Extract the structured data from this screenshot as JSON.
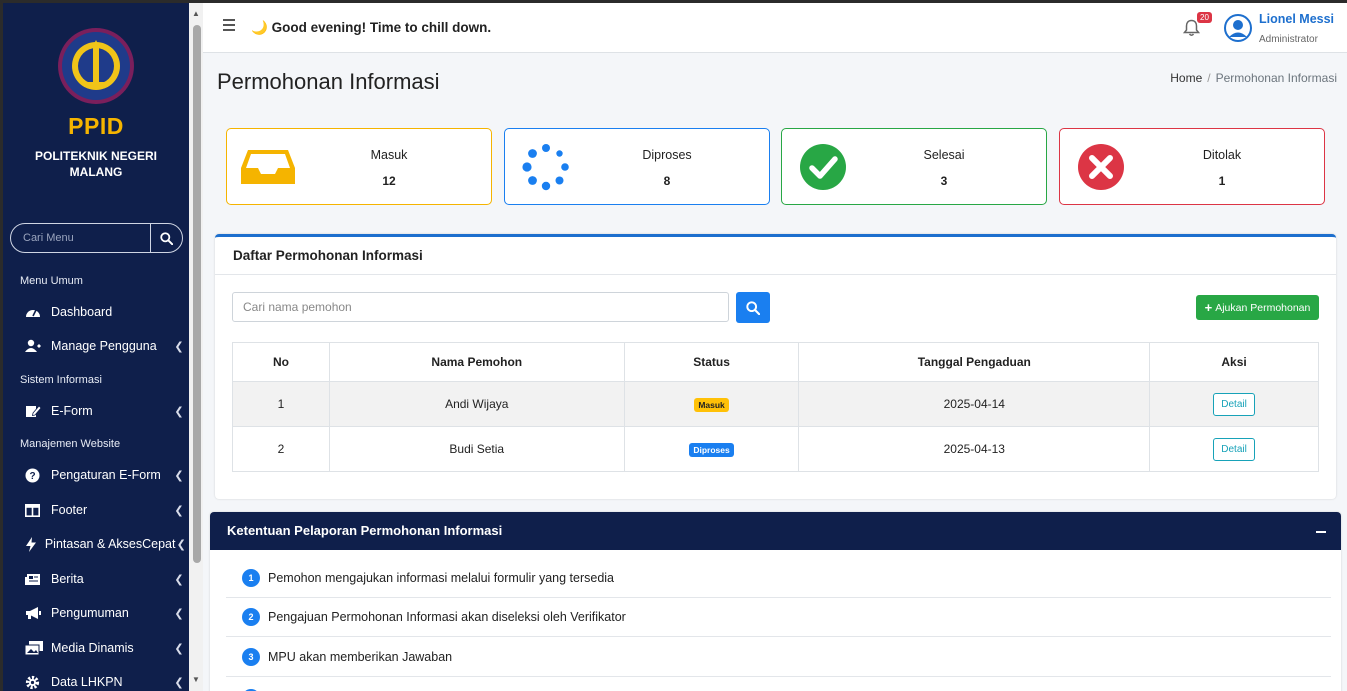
{
  "sidebar": {
    "brand_title": "PPID",
    "brand_sub_line1": "POLITEKNIK NEGERI",
    "brand_sub_line2": "MALANG",
    "logo_text": "POLITEKNIK NEGERI MALANG",
    "search_placeholder": "Cari Menu",
    "sections": [
      "Menu Umum",
      "Sistem Informasi",
      "Manajemen Website"
    ],
    "items": [
      {
        "label": "Dashboard",
        "icon": "dashboard-icon"
      },
      {
        "label": "Manage Pengguna",
        "icon": "users-icon"
      },
      {
        "label": "E-Form",
        "icon": "edit-icon"
      },
      {
        "label": "Pengaturan E-Form",
        "icon": "question-icon"
      },
      {
        "label": "Footer",
        "icon": "layout-icon"
      },
      {
        "label": "Pintasan & AksesCepat",
        "icon": "bolt-icon"
      },
      {
        "label": "Berita",
        "icon": "newspaper-icon"
      },
      {
        "label": "Pengumuman",
        "icon": "megaphone-icon"
      },
      {
        "label": "Media Dinamis",
        "icon": "photos-icon"
      },
      {
        "label": "Data LHKPN",
        "icon": "gear-icon"
      }
    ]
  },
  "header": {
    "greeting": "Good evening! Time to chill down.",
    "notif_count": "20",
    "user_name": "Lionel Messi",
    "user_role": "Administrator"
  },
  "page": {
    "title": "Permohonan Informasi",
    "breadcrumb": [
      "Home",
      "Permohonan Informasi"
    ]
  },
  "stats": [
    {
      "label": "Masuk",
      "value": "12",
      "color": "#f5b400"
    },
    {
      "label": "Diproses",
      "value": "8",
      "color": "#1a7ff0"
    },
    {
      "label": "Selesai",
      "value": "3",
      "color": "#28a745"
    },
    {
      "label": "Ditolak",
      "value": "1",
      "color": "#dc3545"
    }
  ],
  "list": {
    "title": "Daftar Permohonan Informasi",
    "search_placeholder": "Cari nama pemohon",
    "add_label": "Ajukan Permohonan",
    "columns": [
      "No",
      "Nama Pemohon",
      "Status",
      "Tanggal Pengaduan",
      "Aksi"
    ],
    "rows": [
      {
        "no": "1",
        "nama": "Andi Wijaya",
        "status": "Masuk",
        "tanggal": "2025-04-14",
        "aksi": "Detail"
      },
      {
        "no": "2",
        "nama": "Budi Setia",
        "status": "Diproses",
        "tanggal": "2025-04-13",
        "aksi": "Detail"
      }
    ]
  },
  "rules": {
    "title": "Ketentuan Pelaporan Permohonan Informasi",
    "items": [
      {
        "num": "1",
        "text": "Pemohon mengajukan informasi melalui formulir yang tersedia"
      },
      {
        "num": "2",
        "text": "Pengajuan Permohonan Informasi akan diseleksi oleh Verifikator"
      },
      {
        "num": "3",
        "text": "MPU akan memberikan Jawaban"
      }
    ]
  }
}
